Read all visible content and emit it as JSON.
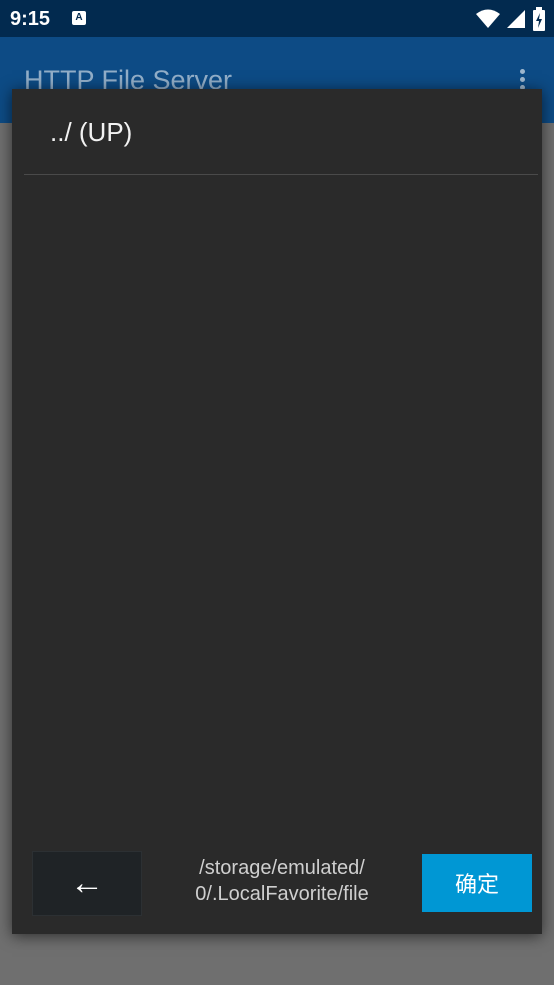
{
  "status_bar": {
    "time": "9:15",
    "notification_glyph": "A",
    "icons": [
      "wifi-icon",
      "cell-signal-icon",
      "battery-charging-icon"
    ]
  },
  "app_bar": {
    "title": "HTTP File Server",
    "menu_icon": "overflow-menu-icon"
  },
  "dialog": {
    "up_item": "../ (UP)",
    "back_label": "←",
    "path_line1": "/storage/emulated/",
    "path_line2": "0/.LocalFavorite/file",
    "confirm_label": "确定"
  },
  "colors": {
    "status_bar": "#022a4f",
    "app_bar": "#0d4b85",
    "dialog_bg": "#2a2a2a",
    "confirm": "#0097d4"
  }
}
